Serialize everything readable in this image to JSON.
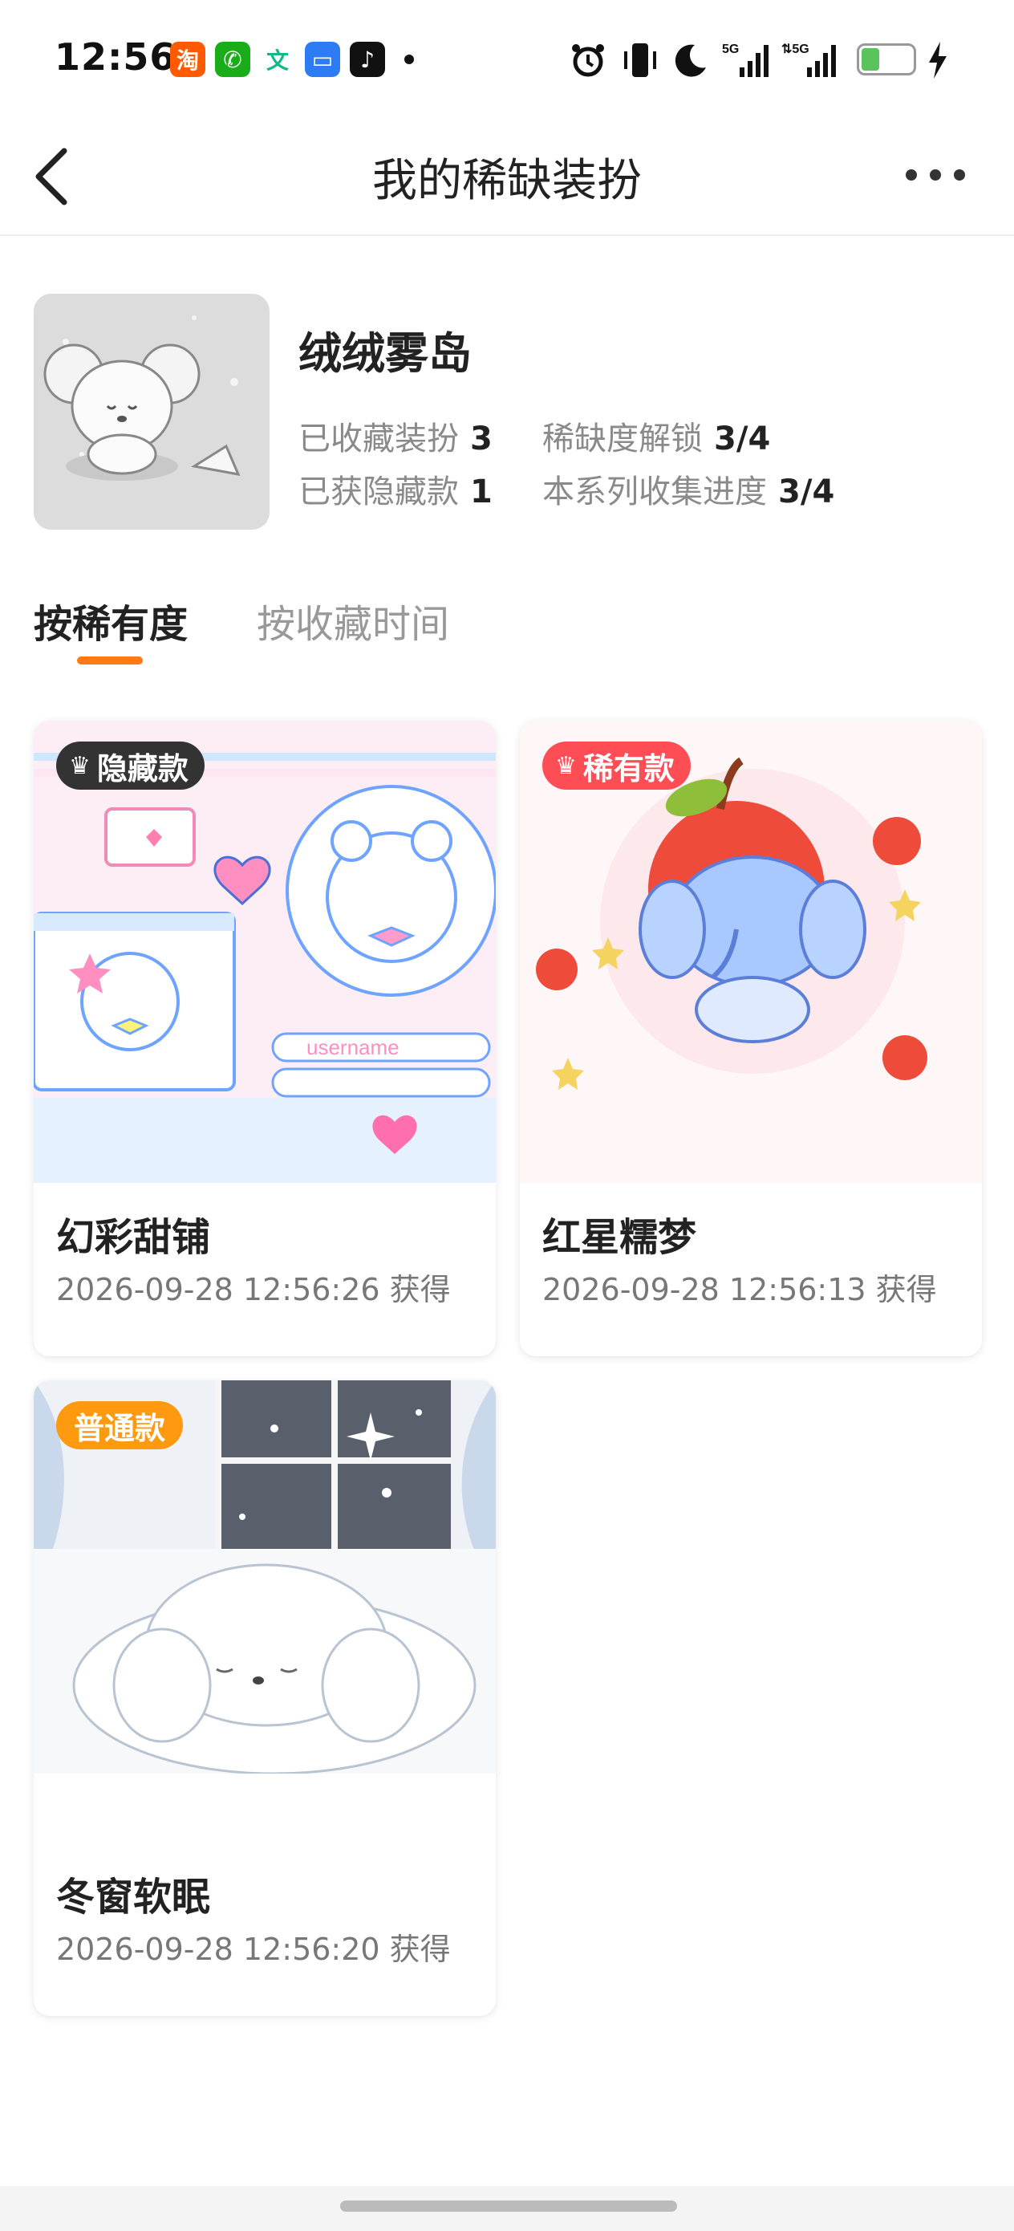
{
  "status_bar": {
    "time": "12:56",
    "apps": [
      {
        "name": "taobao-icon",
        "glyph": "淘",
        "color": "#ff5a00"
      },
      {
        "name": "wechat-icon",
        "glyph": "✆",
        "color": "#1aad19"
      },
      {
        "name": "translate-icon",
        "glyph": "文",
        "color": "#11b88a"
      },
      {
        "name": "files-icon",
        "glyph": "▭",
        "color": "#2d7cf6"
      },
      {
        "name": "tiktok-icon",
        "glyph": "♪",
        "color": "#111111"
      }
    ],
    "network": "5G",
    "battery": "7"
  },
  "nav": {
    "title": "我的稀缺装扮"
  },
  "series": {
    "name": "绒绒雾岛",
    "stats": [
      {
        "label": "已收藏装扮",
        "value": "3"
      },
      {
        "label": "稀缺度解锁",
        "value": "3/4"
      },
      {
        "label": "已获隐藏款",
        "value": "1"
      },
      {
        "label": "本系列收集进度",
        "value": "3/4"
      }
    ]
  },
  "tabs": [
    {
      "label": "按稀有度",
      "active": true
    },
    {
      "label": "按收藏时间",
      "active": false
    }
  ],
  "cards": [
    {
      "name": "幻彩甜铺",
      "date": "2026-09-28 12:56:26 获得",
      "badge": "隐藏款",
      "badge_color": "#333333",
      "image_text": "username"
    },
    {
      "name": "红星糯梦",
      "date": "2026-09-28 12:56:13 获得",
      "badge": "稀有款",
      "badge_color": "#ff4d55"
    },
    {
      "name": "冬窗软眠",
      "date": "2026-09-28 12:56:20 获得",
      "badge": "普通款",
      "badge_color": "#ff9a10"
    }
  ],
  "colors": {
    "accent": "#ff7a14"
  }
}
